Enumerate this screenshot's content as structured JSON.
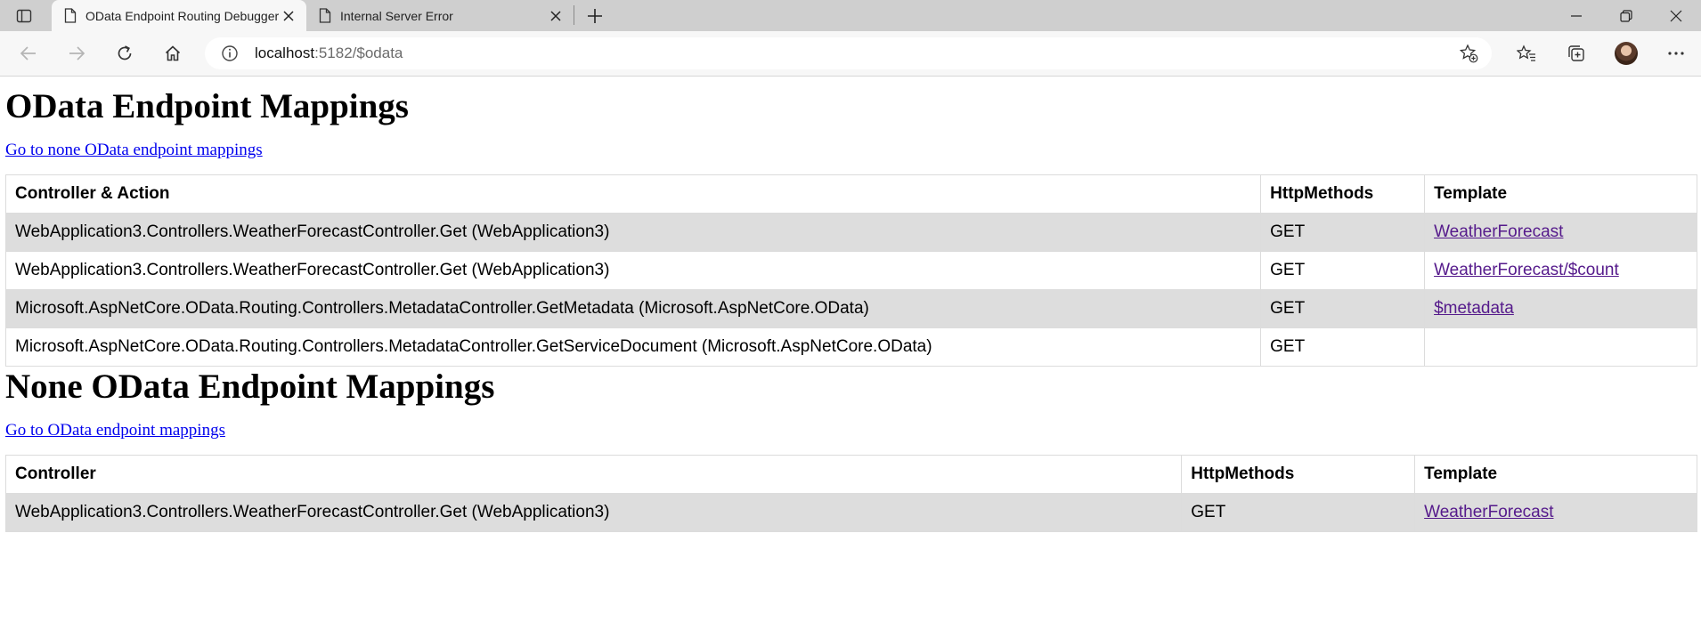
{
  "browser": {
    "tabs": [
      {
        "title": "OData Endpoint Routing Debugger",
        "active": true
      },
      {
        "title": "Internal Server Error",
        "active": false
      }
    ],
    "address": {
      "host": "localhost",
      "rest": ":5182/$odata"
    }
  },
  "odata_section": {
    "heading": "OData Endpoint Mappings",
    "link": "Go to none OData endpoint mappings",
    "columns": [
      "Controller & Action",
      "HttpMethods",
      "Template"
    ],
    "rows": [
      {
        "controller": "WebApplication3.Controllers.WeatherForecastController.Get (WebApplication3)",
        "methods": "GET",
        "template": "WeatherForecast"
      },
      {
        "controller": "WebApplication3.Controllers.WeatherForecastController.Get (WebApplication3)",
        "methods": "GET",
        "template": "WeatherForecast/$count"
      },
      {
        "controller": "Microsoft.AspNetCore.OData.Routing.Controllers.MetadataController.GetMetadata (Microsoft.AspNetCore.OData)",
        "methods": "GET",
        "template": "$metadata"
      },
      {
        "controller": "Microsoft.AspNetCore.OData.Routing.Controllers.MetadataController.GetServiceDocument (Microsoft.AspNetCore.OData)",
        "methods": "GET",
        "template": ""
      }
    ]
  },
  "non_odata_section": {
    "heading": "None OData Endpoint Mappings",
    "link": "Go to OData endpoint mappings",
    "columns": [
      "Controller",
      "HttpMethods",
      "Template"
    ],
    "rows": [
      {
        "controller": "WebApplication3.Controllers.WeatherForecastController.Get (WebApplication3)",
        "methods": "GET",
        "template": "WeatherForecast"
      }
    ]
  }
}
